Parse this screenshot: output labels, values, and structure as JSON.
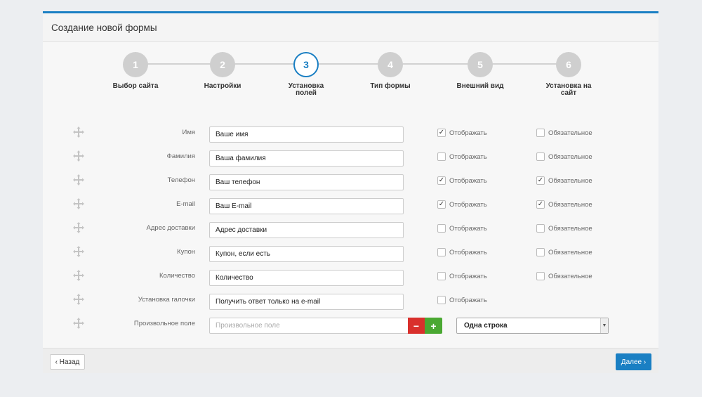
{
  "panel": {
    "title": "Создание новой формы"
  },
  "wizard": {
    "steps": [
      {
        "number": "1",
        "label": "Выбор сайта",
        "active": false
      },
      {
        "number": "2",
        "label": "Настройки",
        "active": false
      },
      {
        "number": "3",
        "label": "Установка полей",
        "active": true
      },
      {
        "number": "4",
        "label": "Тип формы",
        "active": false
      },
      {
        "number": "5",
        "label": "Внешний вид",
        "active": false
      },
      {
        "number": "6",
        "label": "Установка на сайт",
        "active": false
      }
    ]
  },
  "fields": {
    "show_label": "Отображать",
    "required_label": "Обязательное",
    "rows": [
      {
        "label": "Имя",
        "value": "Ваше имя",
        "show": true,
        "required": false,
        "has_required": true
      },
      {
        "label": "Фамилия",
        "value": "Ваша фамилия",
        "show": false,
        "required": false,
        "has_required": true
      },
      {
        "label": "Телефон",
        "value": "Ваш телефон",
        "show": true,
        "required": true,
        "has_required": true
      },
      {
        "label": "E-mail",
        "value": "Ваш E-mail",
        "show": true,
        "required": true,
        "has_required": true
      },
      {
        "label": "Адрес доставки",
        "value": "Адрес доставки",
        "show": false,
        "required": false,
        "has_required": true
      },
      {
        "label": "Купон",
        "value": "Купон, если есть",
        "show": false,
        "required": false,
        "has_required": true
      },
      {
        "label": "Количество",
        "value": "Количество",
        "show": false,
        "required": false,
        "has_required": true
      },
      {
        "label": "Установка галочки",
        "value": "Получить ответ только на e-mail",
        "show": false,
        "required": false,
        "has_required": false
      }
    ]
  },
  "custom_field": {
    "label": "Произвольное поле",
    "placeholder": "Произвольное поле",
    "minus": "−",
    "plus": "+",
    "type_selected": "Одна строка"
  },
  "footer": {
    "back_label": "‹ Назад",
    "next_label": "Далее ›"
  },
  "colors": {
    "accent": "#1a7fc3",
    "danger": "#d9302c",
    "success": "#4aa832"
  }
}
